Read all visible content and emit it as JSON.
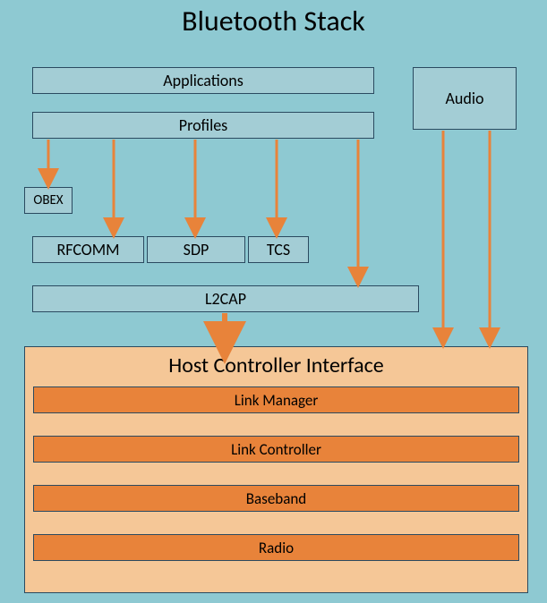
{
  "title": "Bluetooth Stack",
  "boxes": {
    "applications": "Applications",
    "profiles": "Profiles",
    "audio": "Audio",
    "obex": "OBEX",
    "rfcomm": "RFCOMM",
    "sdp": "SDP",
    "tcs": "TCS",
    "l2cap": "L2CAP"
  },
  "hci": {
    "title": "Host Controller Interface",
    "rows": [
      "Link Manager",
      "Link Controller",
      "Baseband",
      "Radio"
    ]
  },
  "colors": {
    "background": "#8ec9d2",
    "upperBox": "#a3cdd5",
    "border": "#2a4a60",
    "hciContainer": "#f5c797",
    "hciRow": "#e8833a",
    "arrow": "#e8833a"
  }
}
